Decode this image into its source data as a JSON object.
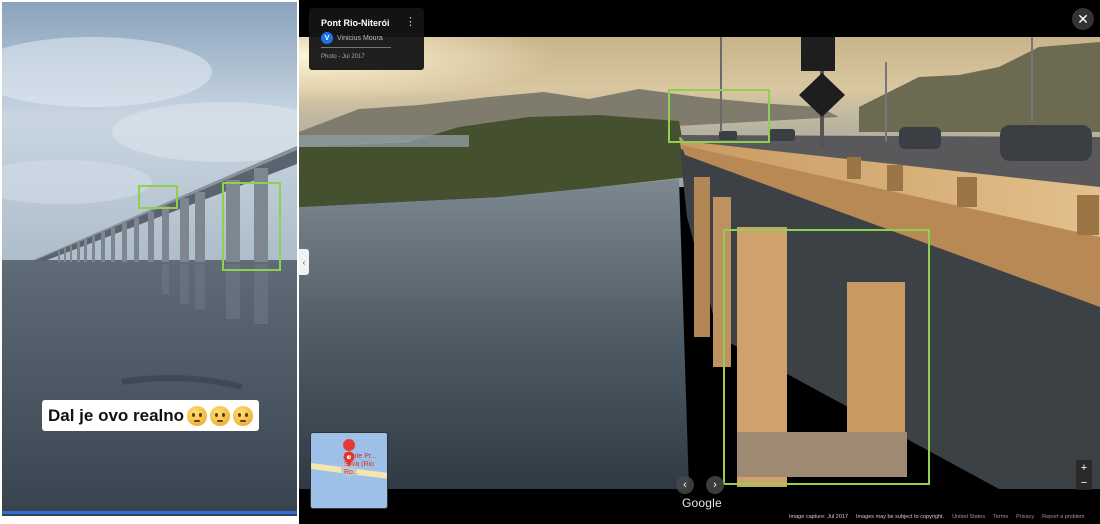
{
  "left_video": {
    "caption": "Dal je ovo realno",
    "emoji_icons": [
      "confused-face-icon",
      "confused-face-icon",
      "confused-face-icon"
    ],
    "progress": 1.0,
    "highlight_color": "#8fd14f"
  },
  "street_view": {
    "title": "Pont Rio-Niterói",
    "author": "Vinicius Moura",
    "author_initial": "V",
    "photo_date": "Photo - Jul 2017",
    "close_icon": "close-icon",
    "minimap_label": "Ponte Pr... Silva (Rio Ro...",
    "logo": "Google",
    "footer": {
      "capture": "Image capture: Jul 2017",
      "copyright": "Images may be subject to copyright.",
      "country": "United States",
      "terms": "Terms",
      "privacy": "Privacy",
      "report": "Report a problem"
    },
    "highlight_color": "#8fd14f"
  }
}
